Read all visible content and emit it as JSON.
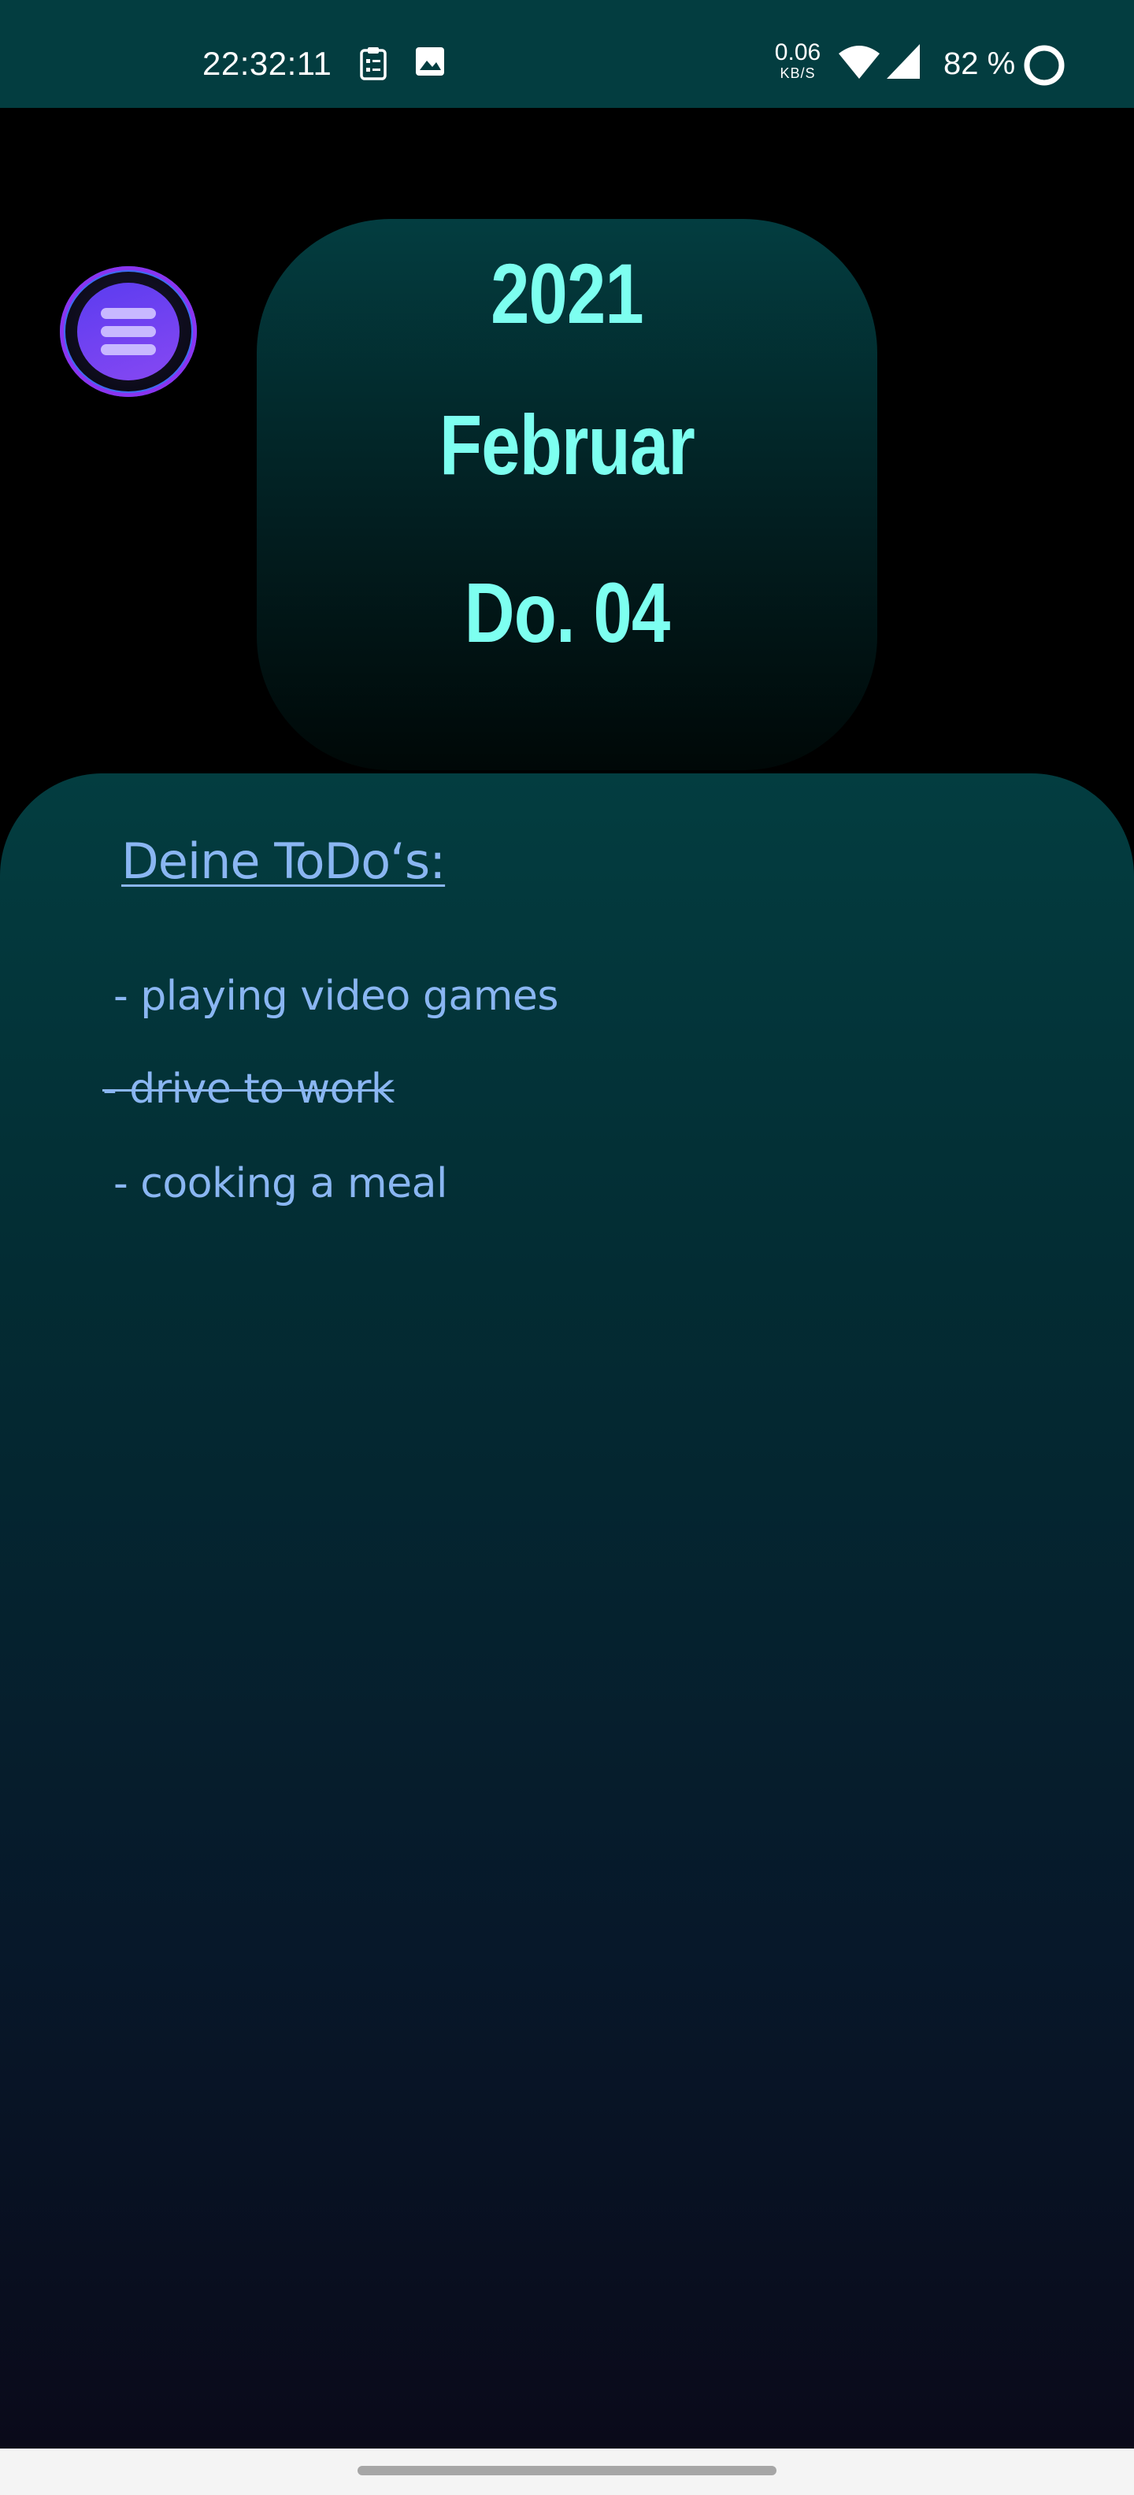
{
  "status_bar": {
    "time": "22:32:11",
    "icons": [
      "clipboard-icon",
      "image-icon",
      "wifi-icon",
      "signal-icon",
      "battery-ring-icon"
    ],
    "net_speed_value": "0.06",
    "net_speed_unit": "KB/S",
    "battery_percent": "82 %",
    "background_color": "#033d40"
  },
  "menu": {
    "icon": "hamburger-menu-icon"
  },
  "date_card": {
    "year": "2021",
    "month": "Februar",
    "day": "Do. 04",
    "text_color": "#7dfff0"
  },
  "todos": {
    "heading": "Deine ToDo‘s:",
    "items": [
      {
        "label": "- playing video games",
        "done": false
      },
      {
        "label": "- drive to work",
        "done": true
      },
      {
        "label": "- cooking a meal",
        "done": false
      }
    ],
    "text_color": "#8ab6f2"
  }
}
